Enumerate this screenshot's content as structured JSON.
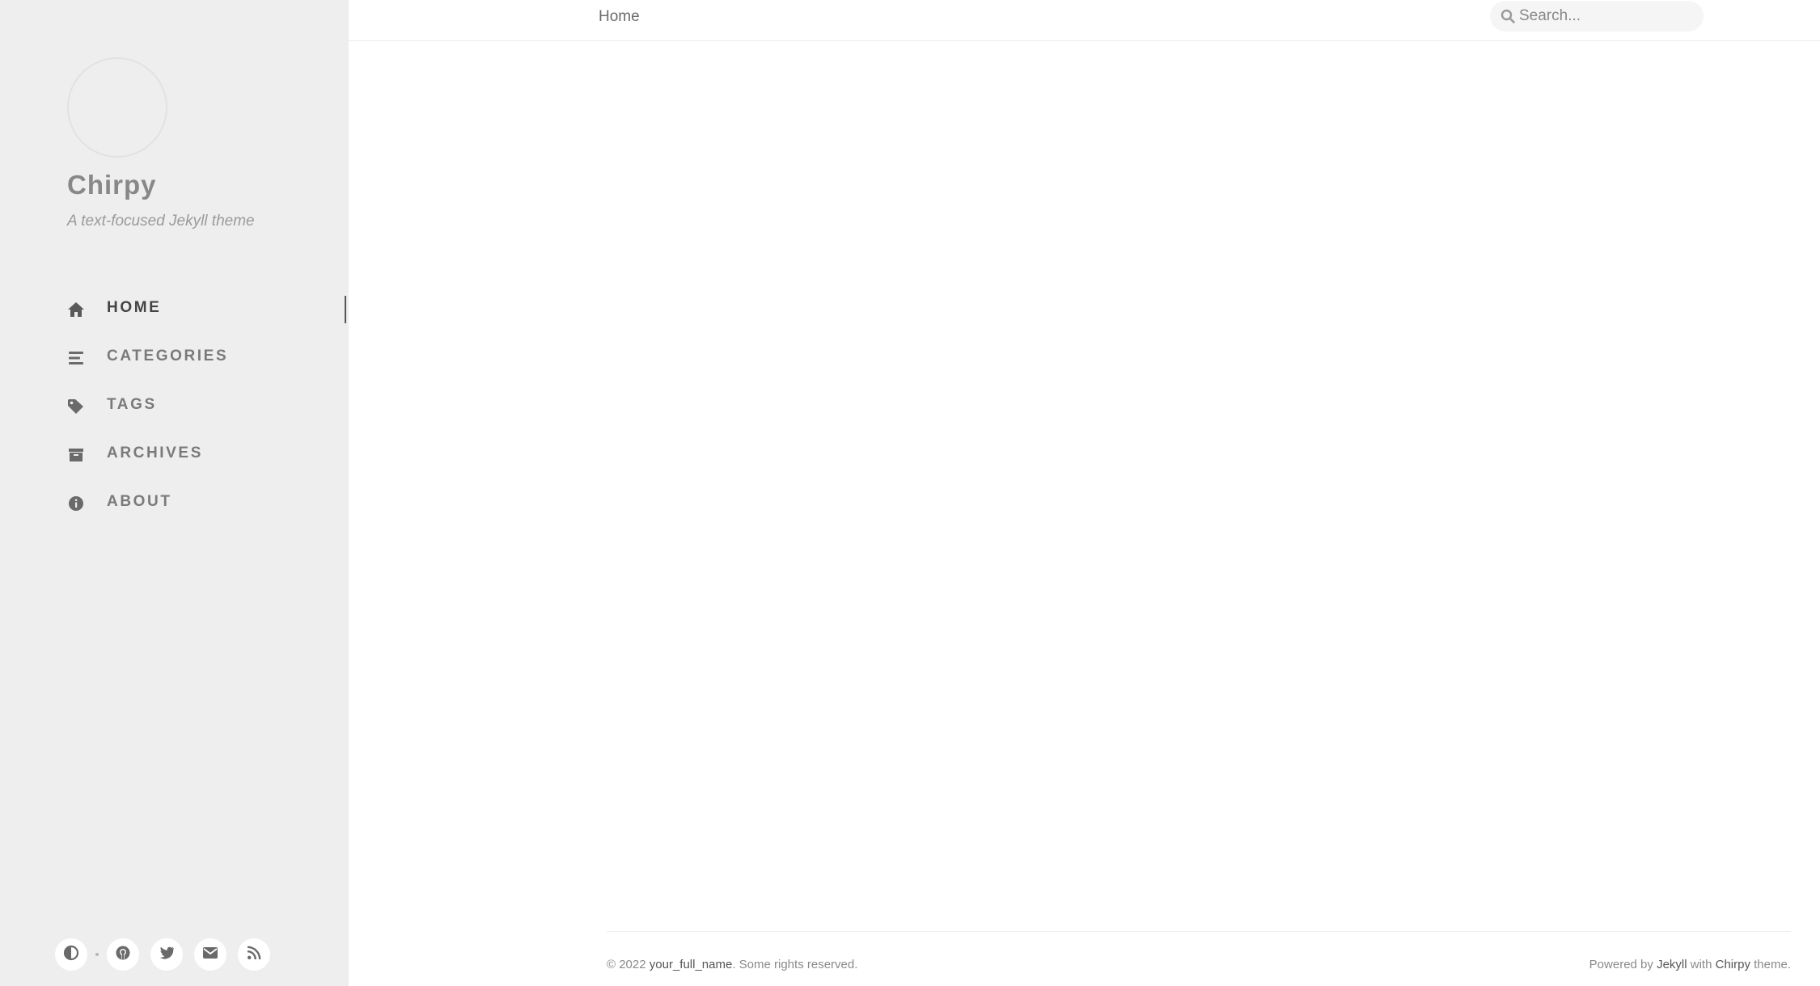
{
  "sidebar": {
    "title": "Chirpy",
    "subtitle": "A text-focused Jekyll theme",
    "nav": [
      {
        "label": "HOME",
        "icon": "home-icon",
        "active": true
      },
      {
        "label": "CATEGORIES",
        "icon": "list-icon",
        "active": false
      },
      {
        "label": "TAGS",
        "icon": "tag-icon",
        "active": false
      },
      {
        "label": "ARCHIVES",
        "icon": "archive-icon",
        "active": false
      },
      {
        "label": "ABOUT",
        "icon": "info-icon",
        "active": false
      }
    ],
    "bottom_buttons": [
      "theme-toggle-icon",
      "github-icon",
      "twitter-icon",
      "email-icon",
      "rss-icon"
    ]
  },
  "topbar": {
    "breadcrumb": "Home",
    "search_placeholder": "Search..."
  },
  "footer": {
    "copyright": "© 2022",
    "author": "your_full_name",
    "rights": ". Some rights reserved.",
    "powered_prefix": "Powered by",
    "jekyll": "Jekyll",
    "with": "with",
    "chirpy": "Chirpy",
    "theme_suffix": "theme."
  },
  "colors": {
    "sidebar_bg": "#eeeeee",
    "nav_text": "#7a7a7a",
    "nav_active": "#444444"
  }
}
